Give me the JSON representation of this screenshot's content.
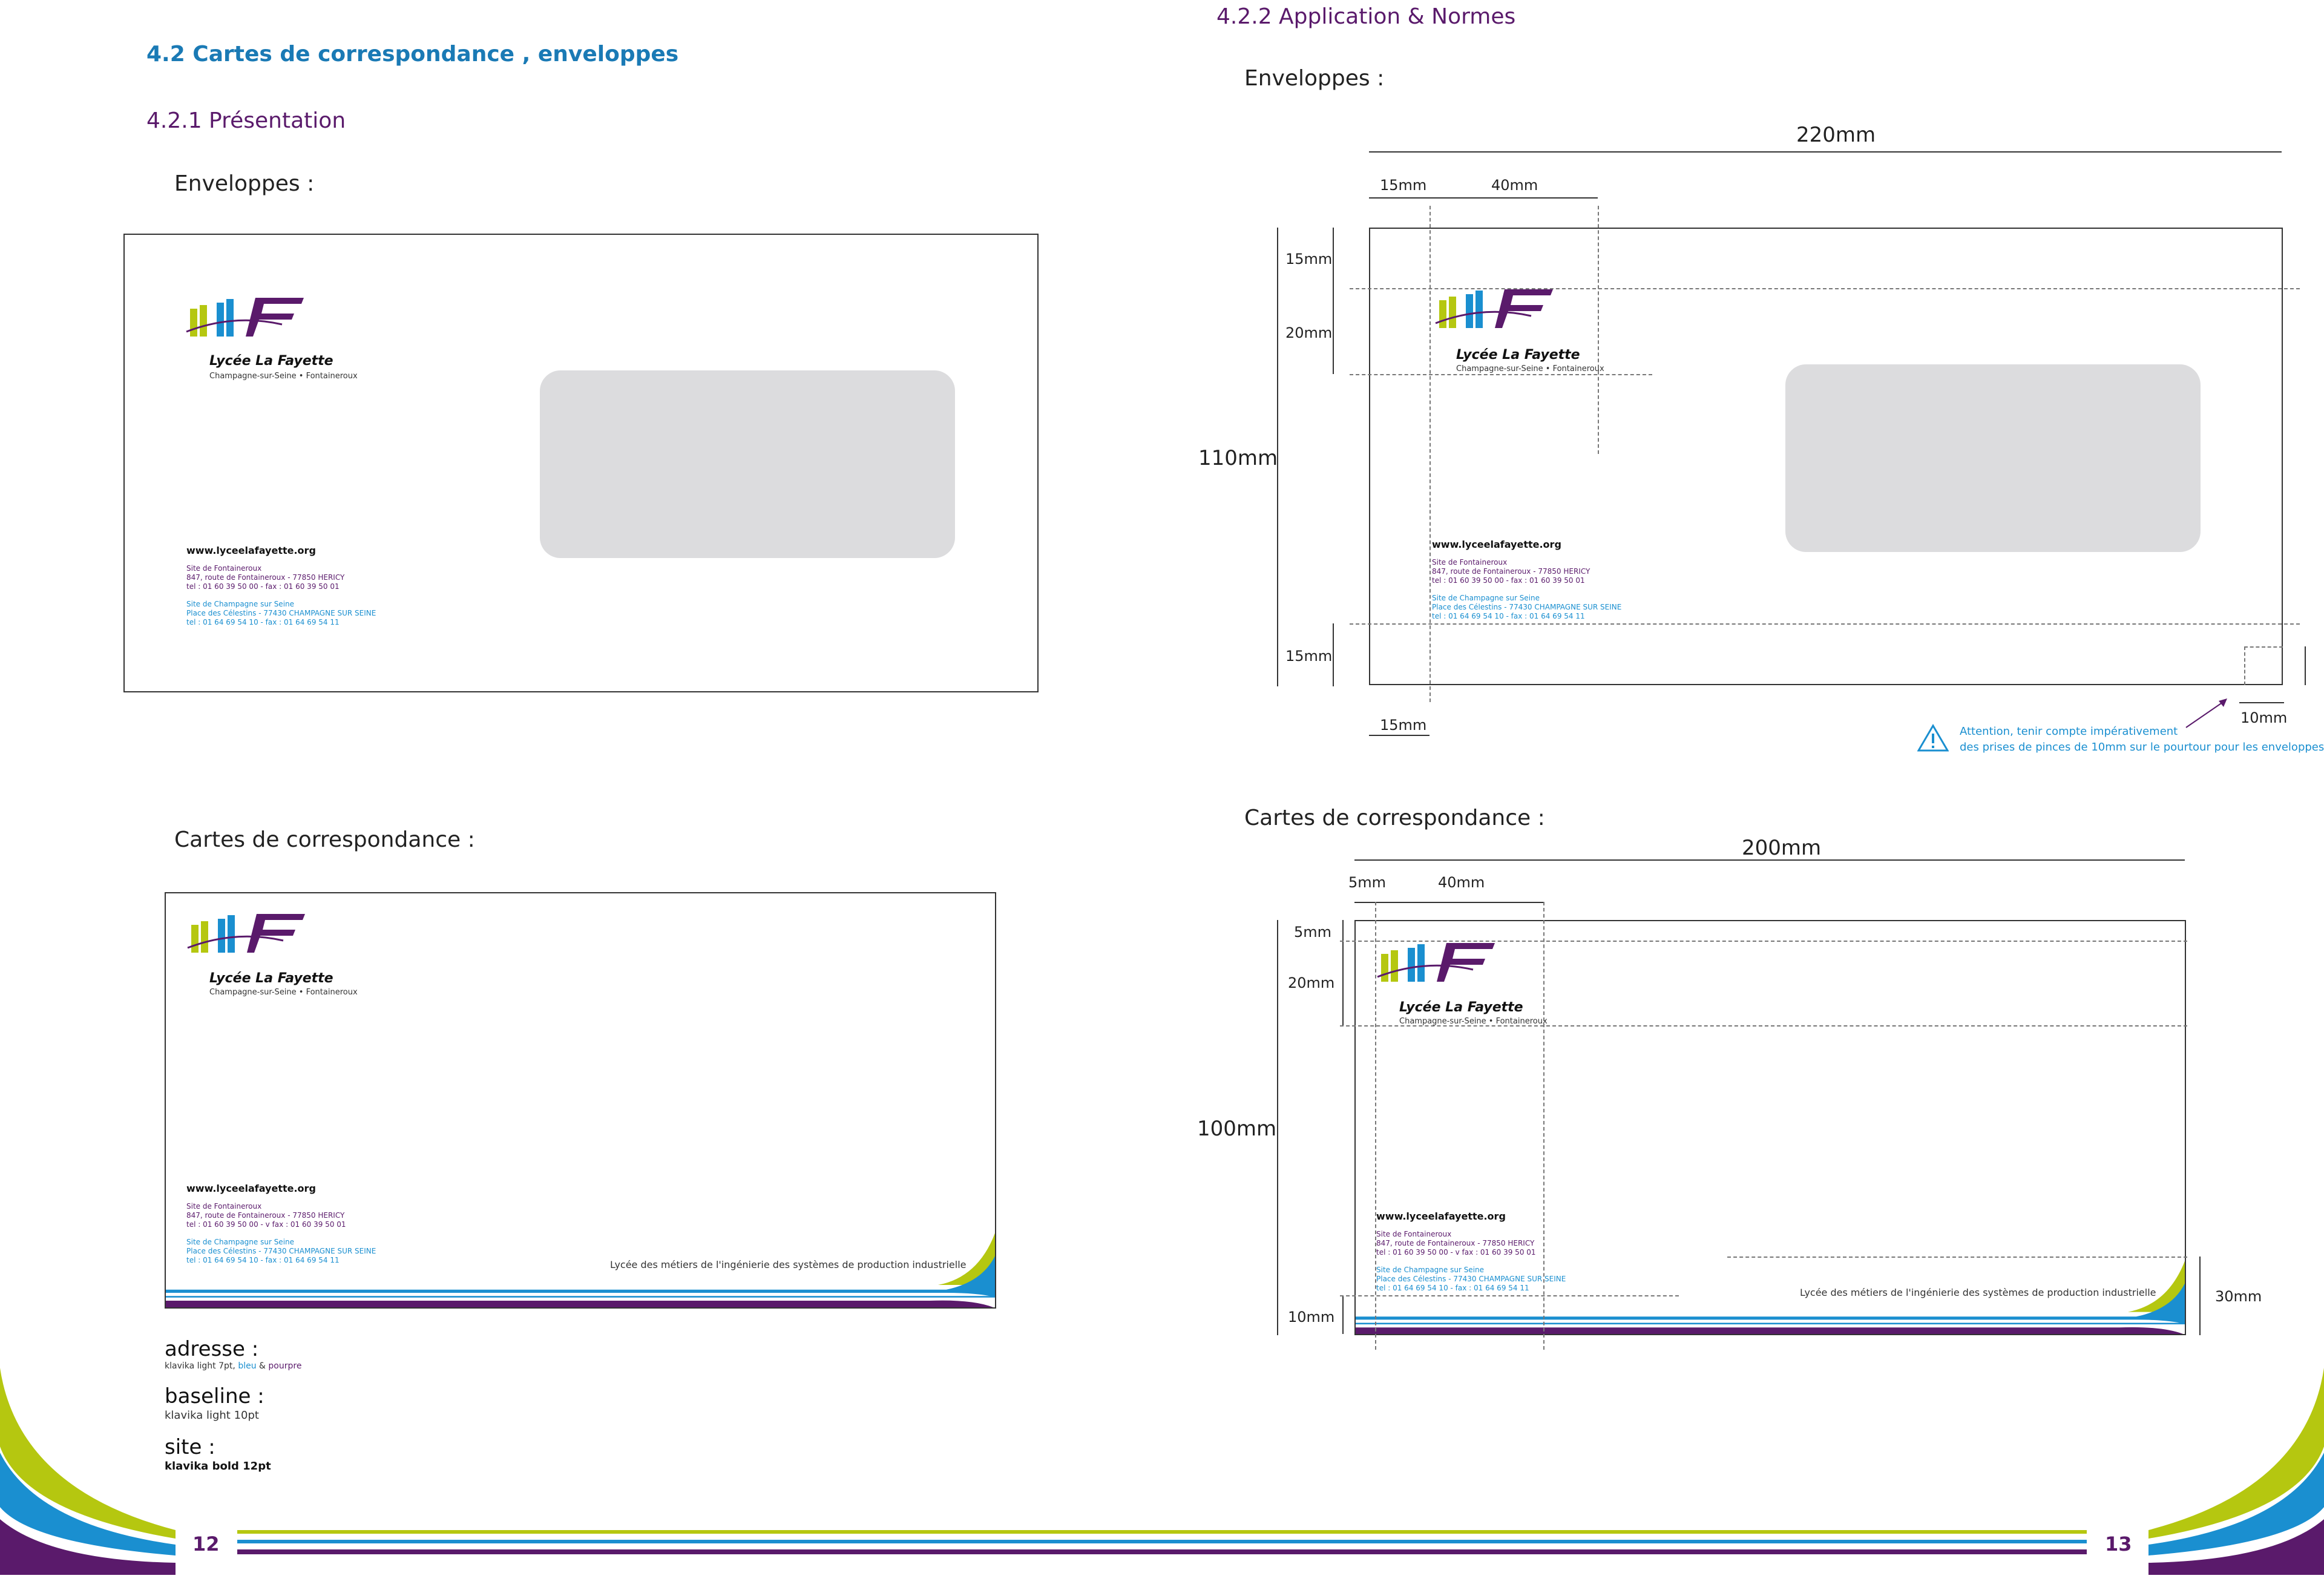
{
  "left_page": {
    "section_title": "4.2 Cartes de correspondance , enveloppes",
    "subsection_title": "4.2.1 Présentation",
    "envelopes_label": "Enveloppes :",
    "cards_label": "Cartes de correspondance :",
    "page_number": "12",
    "specs": [
      {
        "label": "adresse :",
        "value_prefix": "klavika light 7pt, ",
        "value_blue": "bleu",
        "value_mid": " & ",
        "value_purple": "pourpre"
      },
      {
        "label": "baseline :",
        "value": "klavika light 10pt"
      },
      {
        "label": "site :",
        "value": "klavika bold 12pt"
      }
    ]
  },
  "right_page": {
    "subsection_title": "4.2.2 Application & Normes",
    "envelopes_label": "Enveloppes :",
    "cards_label": "Cartes de correspondance :",
    "page_number": "13",
    "envelope_dims": {
      "width": "220mm",
      "height": "110mm",
      "left_margin": "15mm",
      "logo_width": "40mm",
      "top_margin": "15mm",
      "logo_height": "20mm",
      "bottom_margin": "15mm",
      "bottom_left": "15mm",
      "corner": "10mm"
    },
    "warning": {
      "line1": "Attention, tenir compte impérativement",
      "line2": "des prises de pinces de 10mm sur le pourtour pour les enveloppes."
    },
    "card_dims": {
      "width": "200mm",
      "height": "100mm",
      "left_margin": "5mm",
      "logo_width": "40mm",
      "top_margin": "5mm",
      "logo_height": "20mm",
      "bottom_margin": "10mm",
      "band_height": "30mm"
    }
  },
  "brand": {
    "name": "Lycée La Fayette",
    "tagline": "Champagne-sur-Seine • Fontaineroux",
    "website": "www.lyceelafayette.org",
    "site1_title": "Site de Fontaineroux",
    "site1_address": "847, route de Fontaineroux - 77850 HERICY",
    "site1_phone": "tel : 01 60 39 50 00 -   fax : 01 60 39 50 01",
    "site1_phone_card": "tel : 01 60 39 50 00 - v fax : 01 60 39 50 01",
    "site2_title": "Site de Champagne sur Seine",
    "site2_address": "Place des Célestins - 77430 CHAMPAGNE SUR SEINE",
    "site2_phone": "tel : 01 64 69 54 10 -   fax : 01 64 69 54 11",
    "baseline": "Lycée des métiers de l'ingénierie des systèmes de production industrielle"
  },
  "colors": {
    "blue": "#1a7ab5",
    "light_blue": "#1a8fd0",
    "purple": "#5a1a6b",
    "lime": "#b5c710"
  }
}
